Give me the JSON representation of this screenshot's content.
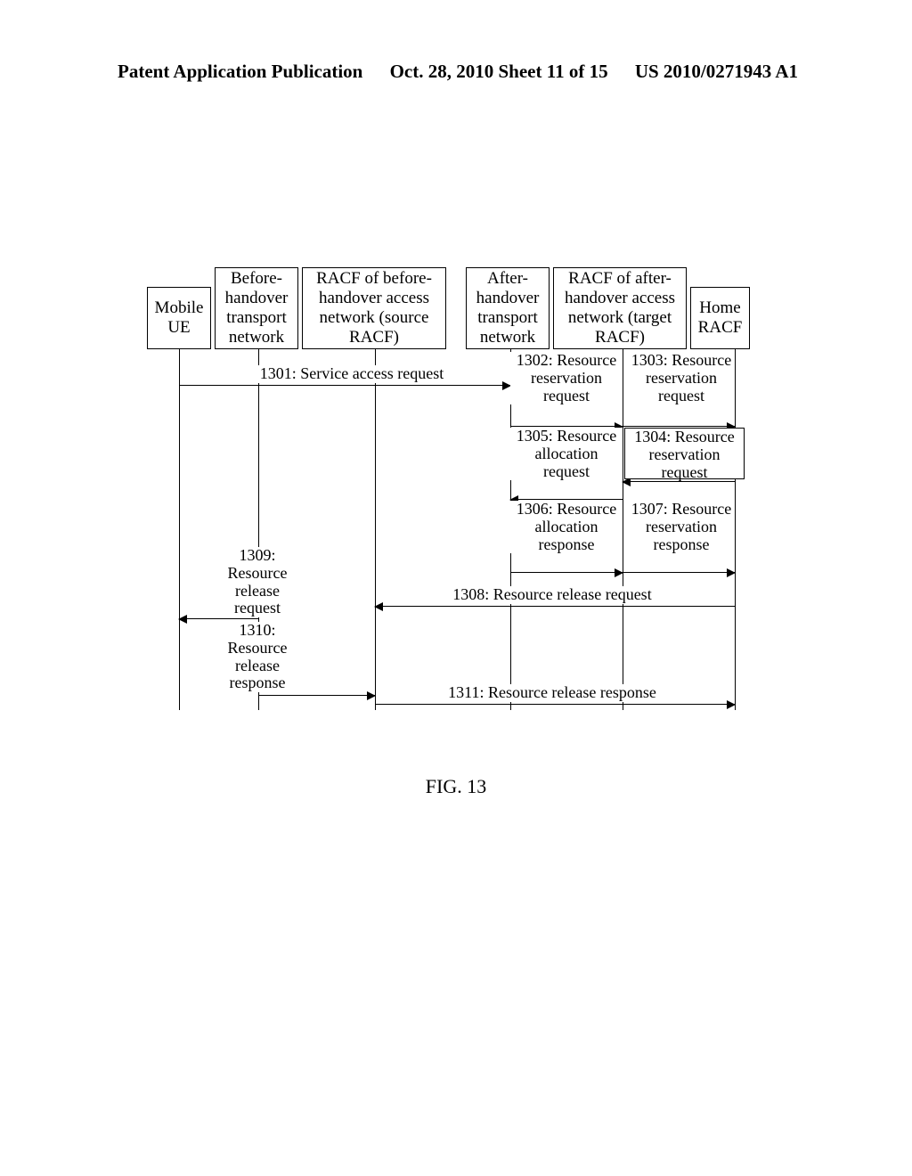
{
  "header": {
    "left": "Patent Application Publication",
    "center": "Oct. 28, 2010  Sheet 11 of 15",
    "right": "US 2010/0271943 A1"
  },
  "participants": {
    "p1": "Mobile UE",
    "p2": "Before-handover transport network",
    "p3": "RACF of before-handover access network (source RACF)",
    "p4": "After-handover transport network",
    "p5": "RACF of after-handover access network (target RACF)",
    "p6": "Home RACF"
  },
  "messages": {
    "m1301": "1301: Service access request",
    "m1302": "1302: Resource reservation request",
    "m1303": "1303: Resource reservation request",
    "m1304": "1304: Resource reservation request",
    "m1305": "1305: Resource allocation request",
    "m1306": "1306: Resource allocation response",
    "m1307": "1307: Resource reservation response",
    "m1308": "1308: Resource release request",
    "m1309": "1309: Resource release request",
    "m1310": "1310: Resource release response",
    "m1311": "1311: Resource release response"
  },
  "figure": {
    "caption": "FIG. 13"
  }
}
